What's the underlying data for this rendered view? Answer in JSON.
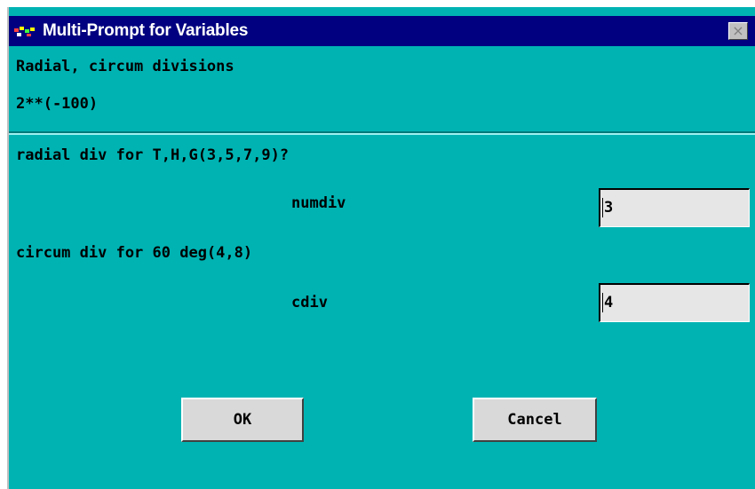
{
  "window": {
    "title": "Multi-Prompt for Variables",
    "close_label": "×"
  },
  "header": {
    "line1": "Radial, circum divisions",
    "line2": "2**(-100)"
  },
  "prompts": [
    {
      "question": "radial div for T,H,G(3,5,7,9)?",
      "variable": "numdiv",
      "value": "3"
    },
    {
      "question": "circum div for 60 deg(4,8)",
      "variable": "cdiv",
      "value": "4"
    }
  ],
  "buttons": {
    "ok_label": "OK",
    "cancel_label": "Cancel"
  },
  "colors": {
    "background": "#00b3b3",
    "titlebar": "#000080"
  }
}
